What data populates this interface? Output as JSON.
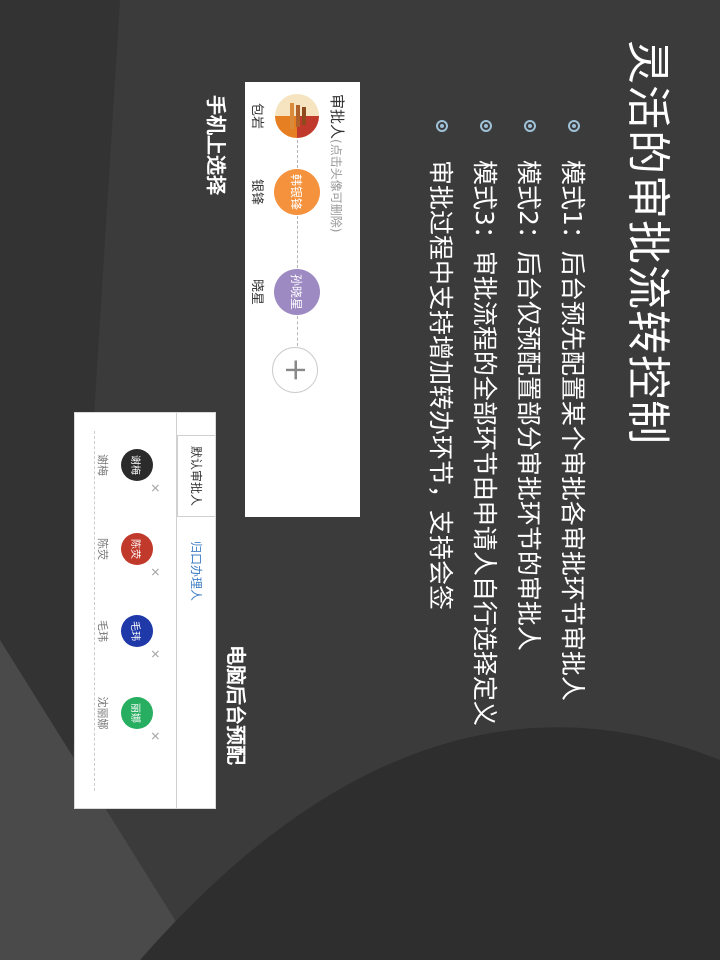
{
  "title": "灵活的审批流转控制",
  "bullets": [
    "模式1：后台预先配置某个审批各审批环节审批人",
    "模式2：后台仅预配置部分审批环节的审批人",
    "模式3：审批流程的全部环节由申请人自行选择定义",
    "审批过程中支持增加转办环节，支持会签"
  ],
  "mobile": {
    "header_label": "审批人",
    "header_hint": "(点击头像可删除)",
    "approvers": [
      {
        "avatar_text": "",
        "name": "包岩",
        "color": "#c0392b"
      },
      {
        "avatar_text": "韩银锋",
        "name": "银锋",
        "color": "#f5923e"
      },
      {
        "avatar_text": "孙晓星",
        "name": "晓星",
        "color": "#9d8ac3"
      }
    ],
    "add_label": "+",
    "caption": "手机上选择"
  },
  "desktop": {
    "tabs": [
      "默认审批人",
      "归口办理人"
    ],
    "people": [
      {
        "avatar_text": "谢梅",
        "name": "谢梅",
        "color": "#2b2b2b"
      },
      {
        "avatar_text": "陈荧",
        "name": "陈荧",
        "color": "#c0392b"
      },
      {
        "avatar_text": "毛玮",
        "name": "毛玮",
        "color": "#1f3aa8"
      },
      {
        "avatar_text": "丽娜",
        "name": "沈丽娜",
        "color": "#27ae60"
      }
    ],
    "close_symbol": "✕",
    "caption": "电脑后台预配"
  },
  "colors": {
    "background": "#3b3b3b",
    "bullet_accent": "#9fc1d7",
    "text": "#ffffff"
  }
}
